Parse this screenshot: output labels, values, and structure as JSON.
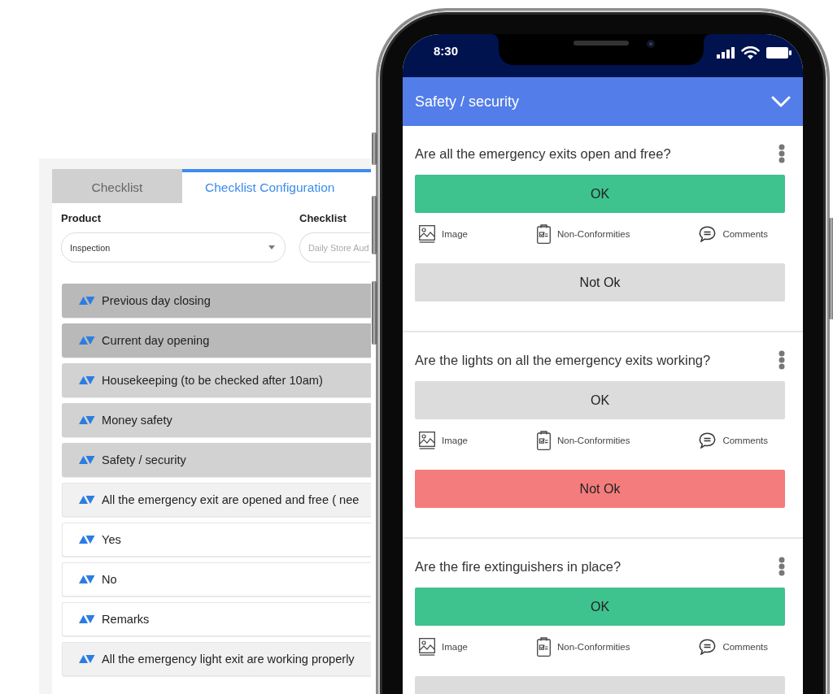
{
  "config_panel": {
    "tabs": [
      {
        "label": "Checklist",
        "selected": false
      },
      {
        "label": "Checklist Configuration",
        "selected": true
      }
    ],
    "fields": [
      {
        "kind": "select",
        "label": "Product",
        "value": "Inspection",
        "disabled": false
      },
      {
        "kind": "text",
        "label": "Checklist",
        "value": "Daily Store Aud",
        "disabled": true
      }
    ],
    "rows": [
      {
        "kind": "heading",
        "text": "Previous day closing"
      },
      {
        "kind": "heading",
        "text": "Current day opening"
      },
      {
        "kind": "section",
        "text": "Housekeeping (to be checked after 10am)"
      },
      {
        "kind": "section",
        "text": "Money safety"
      },
      {
        "kind": "section",
        "text": "Safety / security"
      },
      {
        "kind": "question",
        "text": "All the emergency exit are opened and free ( nee"
      },
      {
        "kind": "option",
        "text": "Yes"
      },
      {
        "kind": "option",
        "text": "No"
      },
      {
        "kind": "option",
        "text": "Remarks"
      },
      {
        "kind": "question",
        "text": "All the emergency light exit are working properly"
      }
    ]
  },
  "phone": {
    "status_bar": {
      "time": "8:30"
    },
    "header": {
      "title": "Safety / security"
    },
    "questions": [
      {
        "text": "Are all the emergency exits open and free?",
        "answers": [
          {
            "kind": "ok",
            "label": "OK",
            "selected": true
          },
          {
            "kind": "not_ok",
            "label": "Not Ok",
            "selected": false
          }
        ],
        "actions": [
          {
            "kind": "image",
            "label": "Image"
          },
          {
            "kind": "nonconformities",
            "label": "Non-Conformities"
          },
          {
            "kind": "comments",
            "label": "Comments"
          }
        ]
      },
      {
        "text": "Are the lights on all the emergency exits working?",
        "answers": [
          {
            "kind": "ok",
            "label": "OK",
            "selected": false
          },
          {
            "kind": "not_ok",
            "label": "Not Ok",
            "selected": true
          }
        ],
        "actions": [
          {
            "kind": "image",
            "label": "Image"
          },
          {
            "kind": "nonconformities",
            "label": "Non-Conformities"
          },
          {
            "kind": "comments",
            "label": "Comments"
          }
        ]
      },
      {
        "text": "Are the fire extinguishers in place?",
        "answers": [
          {
            "kind": "ok",
            "label": "OK",
            "selected": true
          },
          {
            "kind": "not_ok",
            "selected": false
          }
        ],
        "actions": [
          {
            "kind": "image",
            "label": "Image"
          },
          {
            "kind": "nonconformities",
            "label": "Non-Conformities"
          },
          {
            "kind": "comments",
            "label": "Comments"
          }
        ]
      }
    ]
  }
}
